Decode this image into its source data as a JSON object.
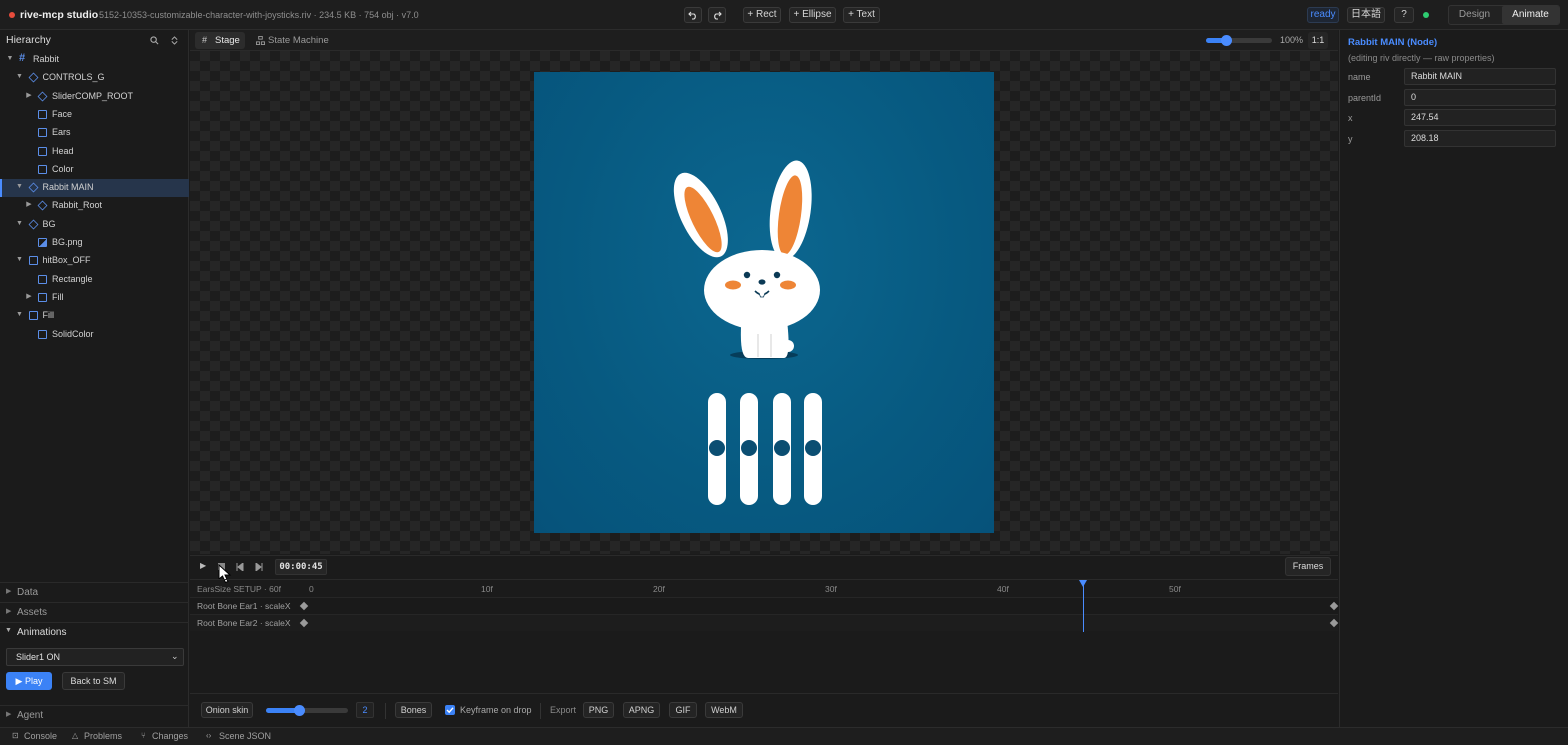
{
  "app": {
    "name": "rive-mcp studio",
    "file_info": "5152-10353-customizable-character-with-joysticks.riv · 234.5 KB · 754 obj · v7.0",
    "status_dot_color": "#e74c3c"
  },
  "toolbar": {
    "undo_icon": "undo-icon",
    "redo_icon": "redo-icon",
    "rect": "+ Rect",
    "ellipse": "+ Ellipse",
    "text": "+ Text"
  },
  "top_right": {
    "status": "ready",
    "language": "日本語",
    "help": "?",
    "connection_color": "#2ecc71",
    "modes": [
      "Design",
      "Animate"
    ],
    "active_mode": "Animate"
  },
  "hierarchy": {
    "title": "Hierarchy",
    "items": [
      {
        "label": "Rabbit",
        "depth": 0,
        "icon": "artboard-icon",
        "caret": "down"
      },
      {
        "label": "CONTROLS_G",
        "depth": 1,
        "icon": "group-icon",
        "caret": "down"
      },
      {
        "label": "SliderCOMP_ROOT",
        "depth": 2,
        "icon": "group-icon",
        "caret": "right"
      },
      {
        "label": "Face",
        "depth": 2,
        "icon": "shape-icon",
        "caret": ""
      },
      {
        "label": "Ears",
        "depth": 2,
        "icon": "shape-icon",
        "caret": ""
      },
      {
        "label": "Head",
        "depth": 2,
        "icon": "shape-icon",
        "caret": ""
      },
      {
        "label": "Color",
        "depth": 2,
        "icon": "shape-icon",
        "caret": ""
      },
      {
        "label": "Rabbit MAIN",
        "depth": 1,
        "icon": "group-icon",
        "caret": "down",
        "selected": true
      },
      {
        "label": "Rabbit_Root",
        "depth": 2,
        "icon": "group-icon",
        "caret": "right"
      },
      {
        "label": "BG",
        "depth": 1,
        "icon": "group-icon",
        "caret": "down"
      },
      {
        "label": "BG.png",
        "depth": 2,
        "icon": "image-icon",
        "caret": ""
      },
      {
        "label": "hitBox_OFF",
        "depth": 1,
        "icon": "shape-icon",
        "caret": "down"
      },
      {
        "label": "Rectangle",
        "depth": 2,
        "icon": "shape-icon",
        "caret": ""
      },
      {
        "label": "Fill",
        "depth": 2,
        "icon": "shape-icon",
        "caret": "right"
      },
      {
        "label": "Fill",
        "depth": 1,
        "icon": "shape-icon",
        "caret": "down"
      },
      {
        "label": "SolidColor",
        "depth": 2,
        "icon": "shape-icon",
        "caret": ""
      }
    ]
  },
  "sidebar_sections": {
    "data": "Data",
    "assets": "Assets",
    "animations": "Animations",
    "agent": "Agent"
  },
  "animations": {
    "selected": "Slider1 ON",
    "play": "▶ Play",
    "back": "Back to SM"
  },
  "canvas": {
    "tabs": [
      "Stage",
      "State Machine"
    ],
    "active_tab": "Stage",
    "zoom": "100%",
    "zoom_level": 0.3,
    "ratio": "1:1",
    "artboard_color": "#075a81"
  },
  "timeline": {
    "time": "00:00:45",
    "frames_button": "Frames",
    "header": "EarsSize SETUP · 60f",
    "ticks": [
      "0",
      "10f",
      "20f",
      "30f",
      "40f",
      "50f"
    ],
    "playhead_frame": 45,
    "total_frames": 60,
    "tracks": [
      "Root Bone Ear1 · scaleX",
      "Root Bone Ear2 · scaleX"
    ]
  },
  "bottom_bar": {
    "onion": "Onion skin",
    "onion_value": "2",
    "onion_level": 0.4,
    "bones": "Bones",
    "keyframe": "Keyframe on drop",
    "keyframe_checked": true,
    "export_label": "Export",
    "export_buttons": [
      "PNG",
      "APNG",
      "GIF",
      "WebM"
    ]
  },
  "properties": {
    "title": "Rabbit MAIN (Node)",
    "subtitle": "(editing riv directly — raw properties)",
    "fields": [
      {
        "label": "name",
        "value": "Rabbit MAIN"
      },
      {
        "label": "parentId",
        "value": "0"
      },
      {
        "label": "x",
        "value": "247.54"
      },
      {
        "label": "y",
        "value": "208.18"
      }
    ]
  },
  "statusbar": {
    "items": [
      "Console",
      "Problems",
      "Changes",
      "Scene JSON"
    ]
  }
}
